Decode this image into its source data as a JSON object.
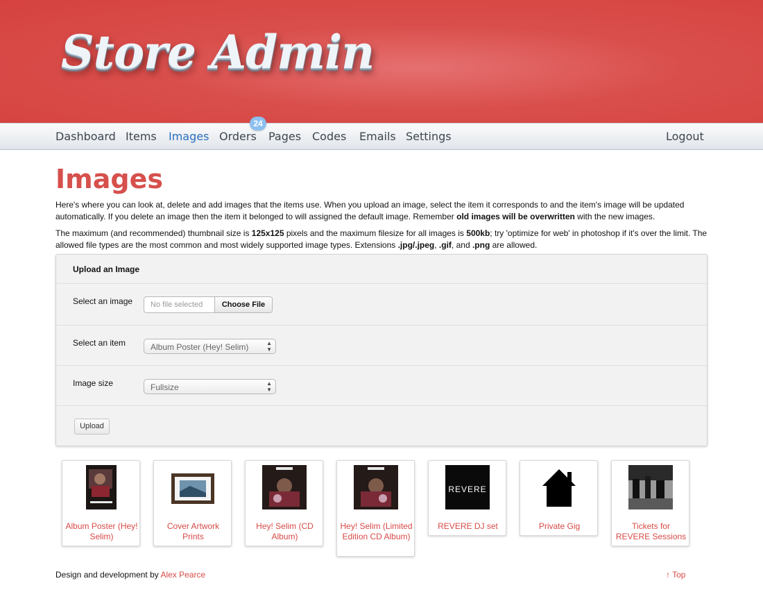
{
  "header": {
    "logo_text": "Store Admin"
  },
  "nav": {
    "items": [
      {
        "label": "Dashboard"
      },
      {
        "label": "Items"
      },
      {
        "label": "Images"
      },
      {
        "label": "Orders",
        "badge": "24"
      },
      {
        "label": "Pages"
      },
      {
        "label": "Codes"
      },
      {
        "label": "Emails"
      },
      {
        "label": "Settings"
      }
    ],
    "active": "Images",
    "logout": "Logout"
  },
  "page": {
    "title": "Images",
    "intro": {
      "p1_a": "Here's where you can look at, delete and add images that the items use. When you upload an image, select the item it corresponds to and the item's image will be updated automatically. If you delete an image then the item it belonged to will assigned the default image. Remember ",
      "p1_b": "old images will be overwritten",
      "p1_c": " with the new images.",
      "p2_a": "The maximum (and recommended) thumbnail size is ",
      "p2_b": "125x125",
      "p2_c": " pixels and the maximum filesize for all images is ",
      "p2_d": "500kb",
      "p2_e": "; try 'optimize for web' in photoshop if it's over the limit. The allowed file types are the most common and most widely supported image types. Extensions ",
      "p2_f": ".jpg/.jpeg",
      "p2_g": ", ",
      "p2_h": ".gif",
      "p2_i": ", and ",
      "p2_j": ".png",
      "p2_k": " are allowed."
    }
  },
  "upload_form": {
    "heading": "Upload an Image",
    "select_image_label": "Select an image",
    "file_status": "No file selected",
    "choose_file_label": "Choose File",
    "select_item_label": "Select an item",
    "selected_item": "Album Poster (Hey! Selim)",
    "image_size_label": "Image size",
    "selected_size": "Fullsize",
    "upload_label": "Upload"
  },
  "images": [
    {
      "label": "Album Poster (Hey! Selim)"
    },
    {
      "label": "Cover Artwork Prints"
    },
    {
      "label": "Hey! Selim (CD Album)"
    },
    {
      "label": "Hey! Selim (Limited Edition CD Album)"
    },
    {
      "label": "REVERE DJ set",
      "thumb_text": "REVERE"
    },
    {
      "label": "Private Gig"
    },
    {
      "label": "Tickets for REVERE Sessions"
    }
  ],
  "footer": {
    "credit_prefix": "Design and development by ",
    "author": "Alex Pearce",
    "top_link": "↑ Top"
  },
  "colors": {
    "banner": "#d94e4b",
    "accent": "#d6504c",
    "nav_active": "#2a6fc1",
    "badge": "#8cc0ee"
  }
}
